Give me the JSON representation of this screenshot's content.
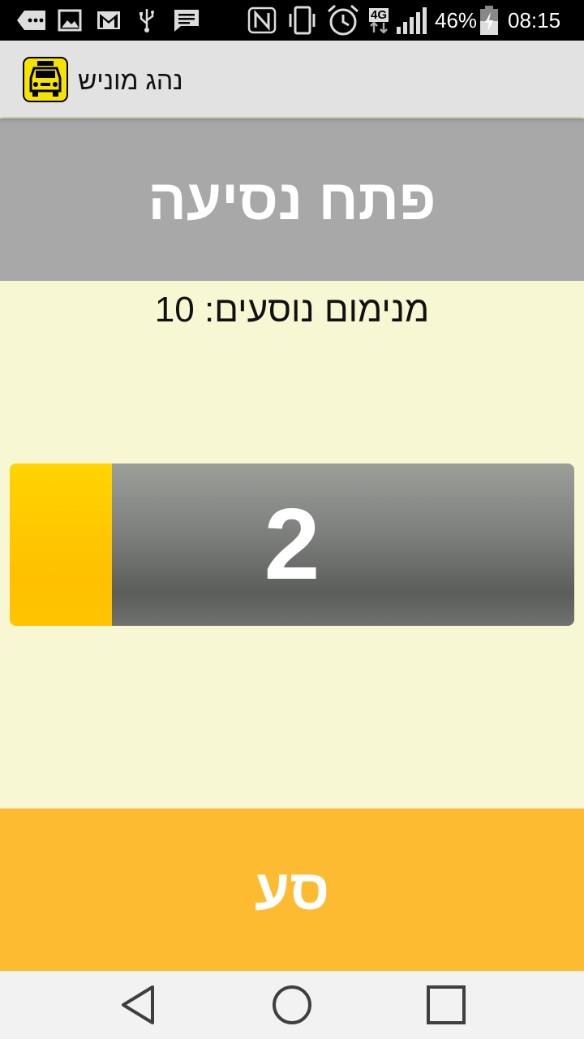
{
  "status_bar": {
    "battery_percent": "46%",
    "time": "08:15",
    "network": "4G",
    "icons": [
      "more-icon",
      "image-icon",
      "gmail-icon",
      "usb-icon",
      "message-icon",
      "nfc-icon",
      "vibrate-icon",
      "alarm-icon",
      "network-4g-icon",
      "signal-icon",
      "battery-charging-icon"
    ]
  },
  "app_bar": {
    "title": "נהג מוניש",
    "logo": "taxi-logo-icon"
  },
  "main": {
    "open_ride_label": "פתח נסיעה",
    "minimum_passengers_text": "מנימום נוסעים: 10",
    "passenger_count": "2",
    "go_button_label": "סע"
  },
  "colors": {
    "background": "#f7f7d3",
    "open_ride_bg": "#a8a8a8",
    "go_button_bg": "#fdbb31",
    "accent_yellow": "#ffc000"
  },
  "nav_bar": {
    "buttons": [
      "back-icon",
      "home-icon",
      "recents-icon"
    ]
  }
}
